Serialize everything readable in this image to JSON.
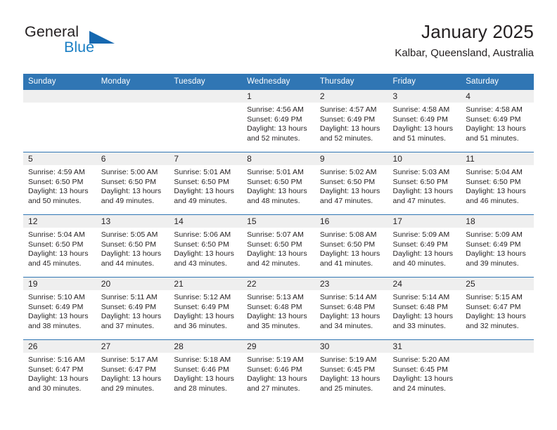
{
  "logo": {
    "word_top": "General",
    "word_bottom": "Blue",
    "accent_color": "#1b7fc4",
    "triangle_color": "#1668b0",
    "triangle_icon": "triangle-icon"
  },
  "header": {
    "title": "January 2025",
    "subtitle": "Kalbar, Queensland, Australia",
    "header_bg_color": "#3076b4",
    "daynum_band_color": "#efefef"
  },
  "weekdays": [
    "Sunday",
    "Monday",
    "Tuesday",
    "Wednesday",
    "Thursday",
    "Friday",
    "Saturday"
  ],
  "labels": {
    "sunrise_prefix": "Sunrise:",
    "sunset_prefix": "Sunset:",
    "daylight_prefix": "Daylight:"
  },
  "weeks": [
    [
      {
        "day": "",
        "empty": true
      },
      {
        "day": "",
        "empty": true
      },
      {
        "day": "",
        "empty": true
      },
      {
        "day": "1",
        "sunrise": "Sunrise: 4:56 AM",
        "sunset": "Sunset: 6:49 PM",
        "daylight_1": "Daylight: 13 hours",
        "daylight_2": "and 52 minutes."
      },
      {
        "day": "2",
        "sunrise": "Sunrise: 4:57 AM",
        "sunset": "Sunset: 6:49 PM",
        "daylight_1": "Daylight: 13 hours",
        "daylight_2": "and 52 minutes."
      },
      {
        "day": "3",
        "sunrise": "Sunrise: 4:58 AM",
        "sunset": "Sunset: 6:49 PM",
        "daylight_1": "Daylight: 13 hours",
        "daylight_2": "and 51 minutes."
      },
      {
        "day": "4",
        "sunrise": "Sunrise: 4:58 AM",
        "sunset": "Sunset: 6:49 PM",
        "daylight_1": "Daylight: 13 hours",
        "daylight_2": "and 51 minutes."
      }
    ],
    [
      {
        "day": "5",
        "sunrise": "Sunrise: 4:59 AM",
        "sunset": "Sunset: 6:50 PM",
        "daylight_1": "Daylight: 13 hours",
        "daylight_2": "and 50 minutes."
      },
      {
        "day": "6",
        "sunrise": "Sunrise: 5:00 AM",
        "sunset": "Sunset: 6:50 PM",
        "daylight_1": "Daylight: 13 hours",
        "daylight_2": "and 49 minutes."
      },
      {
        "day": "7",
        "sunrise": "Sunrise: 5:01 AM",
        "sunset": "Sunset: 6:50 PM",
        "daylight_1": "Daylight: 13 hours",
        "daylight_2": "and 49 minutes."
      },
      {
        "day": "8",
        "sunrise": "Sunrise: 5:01 AM",
        "sunset": "Sunset: 6:50 PM",
        "daylight_1": "Daylight: 13 hours",
        "daylight_2": "and 48 minutes."
      },
      {
        "day": "9",
        "sunrise": "Sunrise: 5:02 AM",
        "sunset": "Sunset: 6:50 PM",
        "daylight_1": "Daylight: 13 hours",
        "daylight_2": "and 47 minutes."
      },
      {
        "day": "10",
        "sunrise": "Sunrise: 5:03 AM",
        "sunset": "Sunset: 6:50 PM",
        "daylight_1": "Daylight: 13 hours",
        "daylight_2": "and 47 minutes."
      },
      {
        "day": "11",
        "sunrise": "Sunrise: 5:04 AM",
        "sunset": "Sunset: 6:50 PM",
        "daylight_1": "Daylight: 13 hours",
        "daylight_2": "and 46 minutes."
      }
    ],
    [
      {
        "day": "12",
        "sunrise": "Sunrise: 5:04 AM",
        "sunset": "Sunset: 6:50 PM",
        "daylight_1": "Daylight: 13 hours",
        "daylight_2": "and 45 minutes."
      },
      {
        "day": "13",
        "sunrise": "Sunrise: 5:05 AM",
        "sunset": "Sunset: 6:50 PM",
        "daylight_1": "Daylight: 13 hours",
        "daylight_2": "and 44 minutes."
      },
      {
        "day": "14",
        "sunrise": "Sunrise: 5:06 AM",
        "sunset": "Sunset: 6:50 PM",
        "daylight_1": "Daylight: 13 hours",
        "daylight_2": "and 43 minutes."
      },
      {
        "day": "15",
        "sunrise": "Sunrise: 5:07 AM",
        "sunset": "Sunset: 6:50 PM",
        "daylight_1": "Daylight: 13 hours",
        "daylight_2": "and 42 minutes."
      },
      {
        "day": "16",
        "sunrise": "Sunrise: 5:08 AM",
        "sunset": "Sunset: 6:50 PM",
        "daylight_1": "Daylight: 13 hours",
        "daylight_2": "and 41 minutes."
      },
      {
        "day": "17",
        "sunrise": "Sunrise: 5:09 AM",
        "sunset": "Sunset: 6:49 PM",
        "daylight_1": "Daylight: 13 hours",
        "daylight_2": "and 40 minutes."
      },
      {
        "day": "18",
        "sunrise": "Sunrise: 5:09 AM",
        "sunset": "Sunset: 6:49 PM",
        "daylight_1": "Daylight: 13 hours",
        "daylight_2": "and 39 minutes."
      }
    ],
    [
      {
        "day": "19",
        "sunrise": "Sunrise: 5:10 AM",
        "sunset": "Sunset: 6:49 PM",
        "daylight_1": "Daylight: 13 hours",
        "daylight_2": "and 38 minutes."
      },
      {
        "day": "20",
        "sunrise": "Sunrise: 5:11 AM",
        "sunset": "Sunset: 6:49 PM",
        "daylight_1": "Daylight: 13 hours",
        "daylight_2": "and 37 minutes."
      },
      {
        "day": "21",
        "sunrise": "Sunrise: 5:12 AM",
        "sunset": "Sunset: 6:49 PM",
        "daylight_1": "Daylight: 13 hours",
        "daylight_2": "and 36 minutes."
      },
      {
        "day": "22",
        "sunrise": "Sunrise: 5:13 AM",
        "sunset": "Sunset: 6:48 PM",
        "daylight_1": "Daylight: 13 hours",
        "daylight_2": "and 35 minutes."
      },
      {
        "day": "23",
        "sunrise": "Sunrise: 5:14 AM",
        "sunset": "Sunset: 6:48 PM",
        "daylight_1": "Daylight: 13 hours",
        "daylight_2": "and 34 minutes."
      },
      {
        "day": "24",
        "sunrise": "Sunrise: 5:14 AM",
        "sunset": "Sunset: 6:48 PM",
        "daylight_1": "Daylight: 13 hours",
        "daylight_2": "and 33 minutes."
      },
      {
        "day": "25",
        "sunrise": "Sunrise: 5:15 AM",
        "sunset": "Sunset: 6:47 PM",
        "daylight_1": "Daylight: 13 hours",
        "daylight_2": "and 32 minutes."
      }
    ],
    [
      {
        "day": "26",
        "sunrise": "Sunrise: 5:16 AM",
        "sunset": "Sunset: 6:47 PM",
        "daylight_1": "Daylight: 13 hours",
        "daylight_2": "and 30 minutes."
      },
      {
        "day": "27",
        "sunrise": "Sunrise: 5:17 AM",
        "sunset": "Sunset: 6:47 PM",
        "daylight_1": "Daylight: 13 hours",
        "daylight_2": "and 29 minutes."
      },
      {
        "day": "28",
        "sunrise": "Sunrise: 5:18 AM",
        "sunset": "Sunset: 6:46 PM",
        "daylight_1": "Daylight: 13 hours",
        "daylight_2": "and 28 minutes."
      },
      {
        "day": "29",
        "sunrise": "Sunrise: 5:19 AM",
        "sunset": "Sunset: 6:46 PM",
        "daylight_1": "Daylight: 13 hours",
        "daylight_2": "and 27 minutes."
      },
      {
        "day": "30",
        "sunrise": "Sunrise: 5:19 AM",
        "sunset": "Sunset: 6:45 PM",
        "daylight_1": "Daylight: 13 hours",
        "daylight_2": "and 25 minutes."
      },
      {
        "day": "31",
        "sunrise": "Sunrise: 5:20 AM",
        "sunset": "Sunset: 6:45 PM",
        "daylight_1": "Daylight: 13 hours",
        "daylight_2": "and 24 minutes."
      },
      {
        "day": "",
        "empty": true
      }
    ]
  ]
}
